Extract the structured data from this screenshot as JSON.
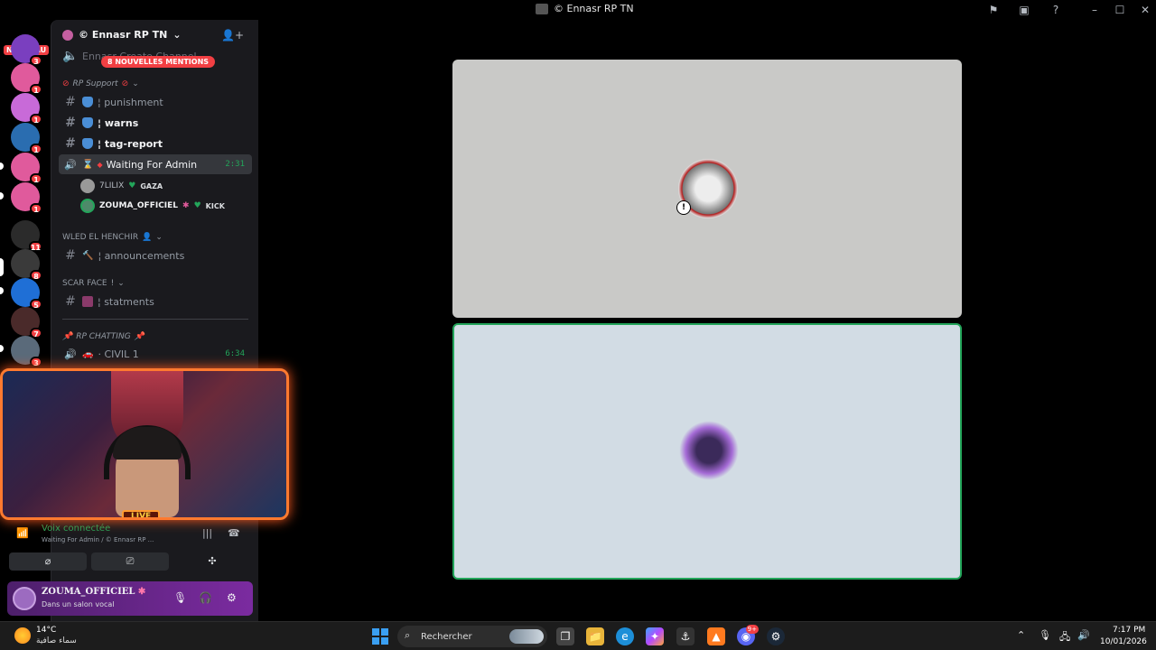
{
  "window": {
    "title": "© Ennasr RP TN"
  },
  "rail": {
    "nouveau_label": "NOUVEAU",
    "servers": [
      {
        "badge": "3",
        "color": "#7a3fbf"
      },
      {
        "badge": "1",
        "color": "#e05a9c"
      },
      {
        "badge": "1",
        "color": "#c86ad8"
      },
      {
        "badge": "1",
        "color": "#2a6db0"
      },
      {
        "badge": "1",
        "color": "#e05a9c"
      },
      {
        "badge": "1",
        "color": "#e05a9c"
      },
      {
        "badge": "11",
        "color": "#2b2b2b"
      },
      {
        "badge": "8",
        "color": "#3a3a3a"
      },
      {
        "badge": "5",
        "color": "#1f6fd6"
      },
      {
        "badge": "7",
        "color": "#4a2a2a"
      },
      {
        "badge": "3",
        "color": "#5a6a7a"
      }
    ]
  },
  "sidebar": {
    "server_name": "© Ennasr RP TN",
    "mentions_banner": "8 NOUVELLES MENTIONS",
    "create_channel_label": "Ennasr Create Channel",
    "categories": {
      "rp_support": "RP Support",
      "wled": "WLED EL HENCHIR",
      "scar": "SCAR FACE",
      "rp_chatting": "RP CHATTING"
    },
    "channels": {
      "punishment": "¦ punishment",
      "warns": "¦ warns",
      "tag_report": "¦ tag-report",
      "waiting": "Waiting For Admin",
      "waiting_time": "2:31",
      "announcements": "¦ announcements",
      "statments": "¦ statments",
      "civil1": "· CIVIL 1",
      "civil1_time": "6:34"
    },
    "members": [
      {
        "name": "7LILIX",
        "tag": "GAZA"
      },
      {
        "name": "ZOUMA_OFFICIEL",
        "tag": "KICK"
      }
    ]
  },
  "webcam": {
    "live_label": "LIVE"
  },
  "voice": {
    "status": "Voix connectée",
    "channel": "Waiting For Admin / © Ennasr RP ..."
  },
  "user": {
    "name": "ZOUMA_OFFICIEL",
    "status": "Dans un salon vocal"
  },
  "taskbar": {
    "temperature": "14°C",
    "weather_desc": "سماء صافية",
    "search_placeholder": "Rechercher",
    "discord_badge": "9+",
    "time": "7:17 PM",
    "date": "10/01/2026"
  },
  "colors": {
    "speaking_border": "#23a55a",
    "mention_red": "#f23f43",
    "accent_purple": "#7b2ba0"
  }
}
